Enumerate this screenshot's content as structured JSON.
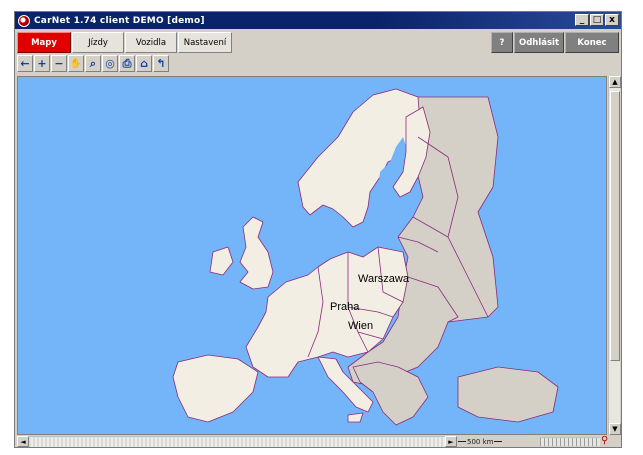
{
  "window": {
    "title": "CarNet  1.74  client DEMO [demo]",
    "controls": [
      "_",
      "□",
      "x"
    ]
  },
  "menu": {
    "tabs": [
      {
        "label": "Mapy",
        "active": true
      },
      {
        "label": "Jízdy",
        "active": false
      },
      {
        "label": "Vozidla",
        "active": false
      },
      {
        "label": "Nastavení",
        "active": false
      }
    ],
    "help_label": "?",
    "logout_label": "Odhlásit",
    "exit_label": "Konec"
  },
  "toolbar": {
    "tools": [
      {
        "name": "back-arrow-icon",
        "glyph": "←"
      },
      {
        "name": "zoom-in-icon",
        "glyph": "+"
      },
      {
        "name": "zoom-out-icon",
        "glyph": "−"
      },
      {
        "name": "pan-hand-icon",
        "glyph": "✋"
      },
      {
        "name": "zoom-search-icon",
        "glyph": "⌕"
      },
      {
        "name": "target-icon",
        "glyph": "◎"
      },
      {
        "name": "print-icon",
        "glyph": "⎙"
      },
      {
        "name": "home-icon",
        "glyph": "⌂"
      },
      {
        "name": "up-arrow-icon",
        "glyph": "↰"
      }
    ]
  },
  "map": {
    "cities": [
      {
        "name": "Warszawa"
      },
      {
        "name": "Praha"
      },
      {
        "name": "Wien"
      }
    ],
    "colors": {
      "sea": "#74b4f8",
      "land_client": "#f3eee4",
      "land_other": "#d4d0c8",
      "border": "#8a2a7a"
    }
  },
  "status": {
    "scale_label": "500 km"
  }
}
